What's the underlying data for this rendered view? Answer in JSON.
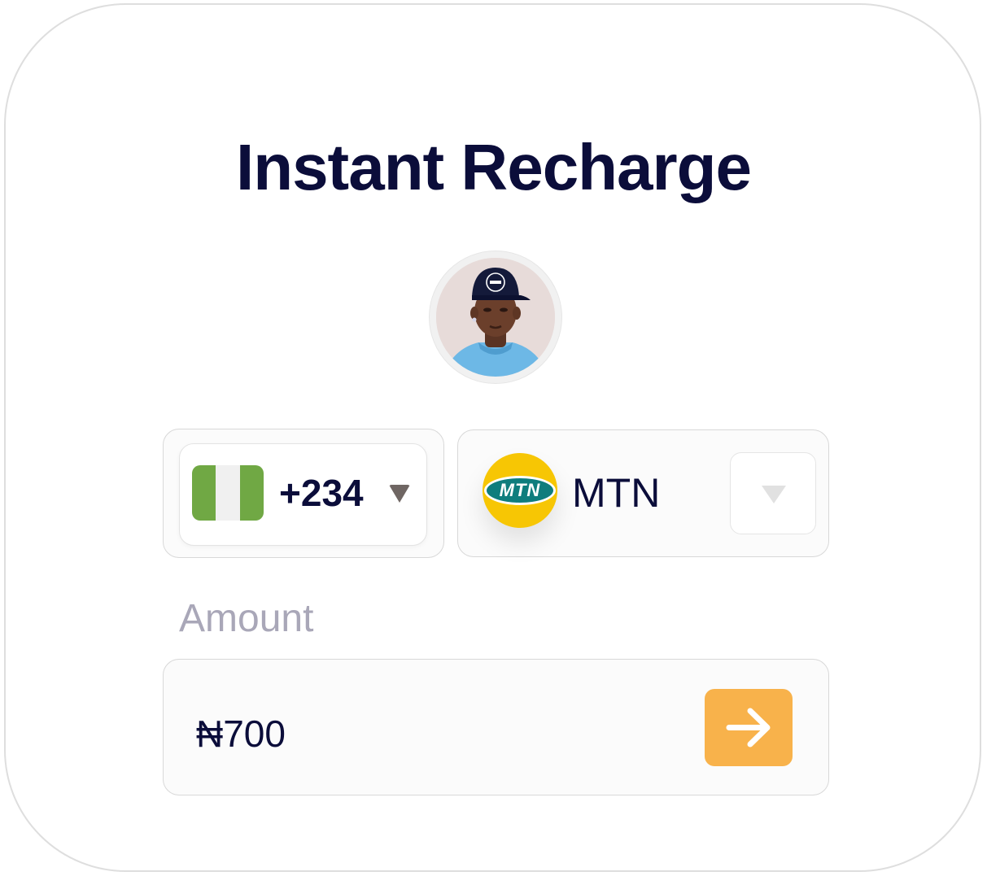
{
  "title": "Instant Recharge",
  "avatar": {
    "alt": "User avatar"
  },
  "country": {
    "dial_code": "+234",
    "flag": {
      "colors": [
        "#70a844",
        "#f0f0f0",
        "#70a844"
      ]
    }
  },
  "network": {
    "logo_text": "MTN",
    "name": "MTN",
    "brand_color": "#f7c604",
    "logo_oval_color": "#0f7d7d"
  },
  "amount": {
    "label": "Amount",
    "value": "₦700"
  },
  "submit": {
    "icon": "arrow-right-icon",
    "color": "#f8b24b"
  },
  "colors": {
    "text_primary": "#0b0d3a",
    "text_muted": "#a9a7b8"
  }
}
